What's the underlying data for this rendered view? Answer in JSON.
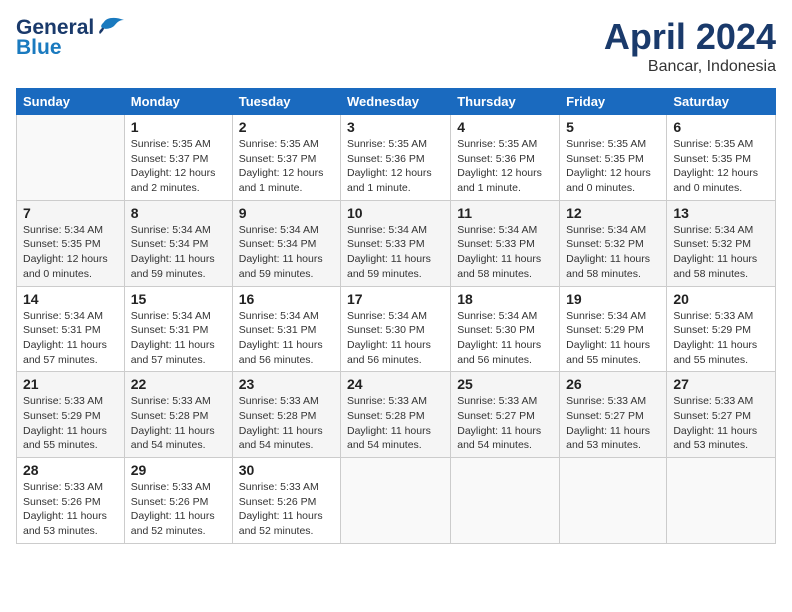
{
  "header": {
    "logo_general": "General",
    "logo_blue": "Blue",
    "title": "April 2024",
    "subtitle": "Bancar, Indonesia"
  },
  "columns": [
    "Sunday",
    "Monday",
    "Tuesday",
    "Wednesday",
    "Thursday",
    "Friday",
    "Saturday"
  ],
  "weeks": [
    [
      {
        "day": "",
        "info": ""
      },
      {
        "day": "1",
        "info": "Sunrise: 5:35 AM\nSunset: 5:37 PM\nDaylight: 12 hours\nand 2 minutes."
      },
      {
        "day": "2",
        "info": "Sunrise: 5:35 AM\nSunset: 5:37 PM\nDaylight: 12 hours\nand 1 minute."
      },
      {
        "day": "3",
        "info": "Sunrise: 5:35 AM\nSunset: 5:36 PM\nDaylight: 12 hours\nand 1 minute."
      },
      {
        "day": "4",
        "info": "Sunrise: 5:35 AM\nSunset: 5:36 PM\nDaylight: 12 hours\nand 1 minute."
      },
      {
        "day": "5",
        "info": "Sunrise: 5:35 AM\nSunset: 5:35 PM\nDaylight: 12 hours\nand 0 minutes."
      },
      {
        "day": "6",
        "info": "Sunrise: 5:35 AM\nSunset: 5:35 PM\nDaylight: 12 hours\nand 0 minutes."
      }
    ],
    [
      {
        "day": "7",
        "info": "Sunrise: 5:34 AM\nSunset: 5:35 PM\nDaylight: 12 hours\nand 0 minutes."
      },
      {
        "day": "8",
        "info": "Sunrise: 5:34 AM\nSunset: 5:34 PM\nDaylight: 11 hours\nand 59 minutes."
      },
      {
        "day": "9",
        "info": "Sunrise: 5:34 AM\nSunset: 5:34 PM\nDaylight: 11 hours\nand 59 minutes."
      },
      {
        "day": "10",
        "info": "Sunrise: 5:34 AM\nSunset: 5:33 PM\nDaylight: 11 hours\nand 59 minutes."
      },
      {
        "day": "11",
        "info": "Sunrise: 5:34 AM\nSunset: 5:33 PM\nDaylight: 11 hours\nand 58 minutes."
      },
      {
        "day": "12",
        "info": "Sunrise: 5:34 AM\nSunset: 5:32 PM\nDaylight: 11 hours\nand 58 minutes."
      },
      {
        "day": "13",
        "info": "Sunrise: 5:34 AM\nSunset: 5:32 PM\nDaylight: 11 hours\nand 58 minutes."
      }
    ],
    [
      {
        "day": "14",
        "info": "Sunrise: 5:34 AM\nSunset: 5:31 PM\nDaylight: 11 hours\nand 57 minutes."
      },
      {
        "day": "15",
        "info": "Sunrise: 5:34 AM\nSunset: 5:31 PM\nDaylight: 11 hours\nand 57 minutes."
      },
      {
        "day": "16",
        "info": "Sunrise: 5:34 AM\nSunset: 5:31 PM\nDaylight: 11 hours\nand 56 minutes."
      },
      {
        "day": "17",
        "info": "Sunrise: 5:34 AM\nSunset: 5:30 PM\nDaylight: 11 hours\nand 56 minutes."
      },
      {
        "day": "18",
        "info": "Sunrise: 5:34 AM\nSunset: 5:30 PM\nDaylight: 11 hours\nand 56 minutes."
      },
      {
        "day": "19",
        "info": "Sunrise: 5:34 AM\nSunset: 5:29 PM\nDaylight: 11 hours\nand 55 minutes."
      },
      {
        "day": "20",
        "info": "Sunrise: 5:33 AM\nSunset: 5:29 PM\nDaylight: 11 hours\nand 55 minutes."
      }
    ],
    [
      {
        "day": "21",
        "info": "Sunrise: 5:33 AM\nSunset: 5:29 PM\nDaylight: 11 hours\nand 55 minutes."
      },
      {
        "day": "22",
        "info": "Sunrise: 5:33 AM\nSunset: 5:28 PM\nDaylight: 11 hours\nand 54 minutes."
      },
      {
        "day": "23",
        "info": "Sunrise: 5:33 AM\nSunset: 5:28 PM\nDaylight: 11 hours\nand 54 minutes."
      },
      {
        "day": "24",
        "info": "Sunrise: 5:33 AM\nSunset: 5:28 PM\nDaylight: 11 hours\nand 54 minutes."
      },
      {
        "day": "25",
        "info": "Sunrise: 5:33 AM\nSunset: 5:27 PM\nDaylight: 11 hours\nand 54 minutes."
      },
      {
        "day": "26",
        "info": "Sunrise: 5:33 AM\nSunset: 5:27 PM\nDaylight: 11 hours\nand 53 minutes."
      },
      {
        "day": "27",
        "info": "Sunrise: 5:33 AM\nSunset: 5:27 PM\nDaylight: 11 hours\nand 53 minutes."
      }
    ],
    [
      {
        "day": "28",
        "info": "Sunrise: 5:33 AM\nSunset: 5:26 PM\nDaylight: 11 hours\nand 53 minutes."
      },
      {
        "day": "29",
        "info": "Sunrise: 5:33 AM\nSunset: 5:26 PM\nDaylight: 11 hours\nand 52 minutes."
      },
      {
        "day": "30",
        "info": "Sunrise: 5:33 AM\nSunset: 5:26 PM\nDaylight: 11 hours\nand 52 minutes."
      },
      {
        "day": "",
        "info": ""
      },
      {
        "day": "",
        "info": ""
      },
      {
        "day": "",
        "info": ""
      },
      {
        "day": "",
        "info": ""
      }
    ]
  ]
}
